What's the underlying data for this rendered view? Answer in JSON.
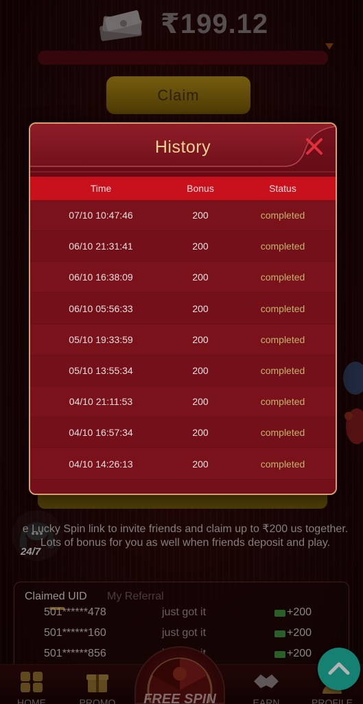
{
  "balance": {
    "amount": "₹199.12",
    "progress_fraction": 0.0
  },
  "claim": {
    "label": "Claim"
  },
  "support": {
    "label": "24/7"
  },
  "invite": {
    "text": "e Lucky Spin link to invite friends and claim up to ₹200 us together. Lots of bonus for you as well when friends deposit and play."
  },
  "referral": {
    "tabs": [
      "Claimed UID",
      "My Referral"
    ],
    "rows": [
      {
        "uid": "501******478",
        "message": "just got it",
        "amount": "+200"
      },
      {
        "uid": "501******160",
        "message": "just got it",
        "amount": "+200"
      },
      {
        "uid": "501******856",
        "message": "just got it",
        "amount": "+200"
      }
    ]
  },
  "bottom_nav": {
    "items": [
      {
        "label": "HOME",
        "icon": "home-icon"
      },
      {
        "label": "PROMO",
        "icon": "gift-icon"
      },
      {
        "label": "FREE SPIN",
        "icon": "spin-wheel-icon"
      },
      {
        "label": "EARN",
        "icon": "handshake-icon"
      },
      {
        "label": "PROFILE",
        "icon": "profile-icon"
      }
    ]
  },
  "history_modal": {
    "title": "History",
    "columns": [
      "Time",
      "Bonus",
      "Status"
    ],
    "rows": [
      {
        "time": "07/10 10:47:46",
        "bonus": "200",
        "status": "completed"
      },
      {
        "time": "06/10 21:31:41",
        "bonus": "200",
        "status": "completed"
      },
      {
        "time": "06/10 16:38:09",
        "bonus": "200",
        "status": "completed"
      },
      {
        "time": "06/10 05:56:33",
        "bonus": "200",
        "status": "completed"
      },
      {
        "time": "05/10 19:33:59",
        "bonus": "200",
        "status": "completed"
      },
      {
        "time": "05/10 13:55:34",
        "bonus": "200",
        "status": "completed"
      },
      {
        "time": "04/10 21:11:53",
        "bonus": "200",
        "status": "completed"
      },
      {
        "time": "04/10 16:57:34",
        "bonus": "200",
        "status": "completed"
      },
      {
        "time": "04/10 14:26:13",
        "bonus": "200",
        "status": "completed"
      }
    ]
  },
  "colors": {
    "modal_bg": "#7c121a",
    "table_header": "#c8111d",
    "title_gold": "#f4d291",
    "status_text": "#c4b36c",
    "accent_teal": "#1fb9a5",
    "close_red": "#e0303a"
  }
}
